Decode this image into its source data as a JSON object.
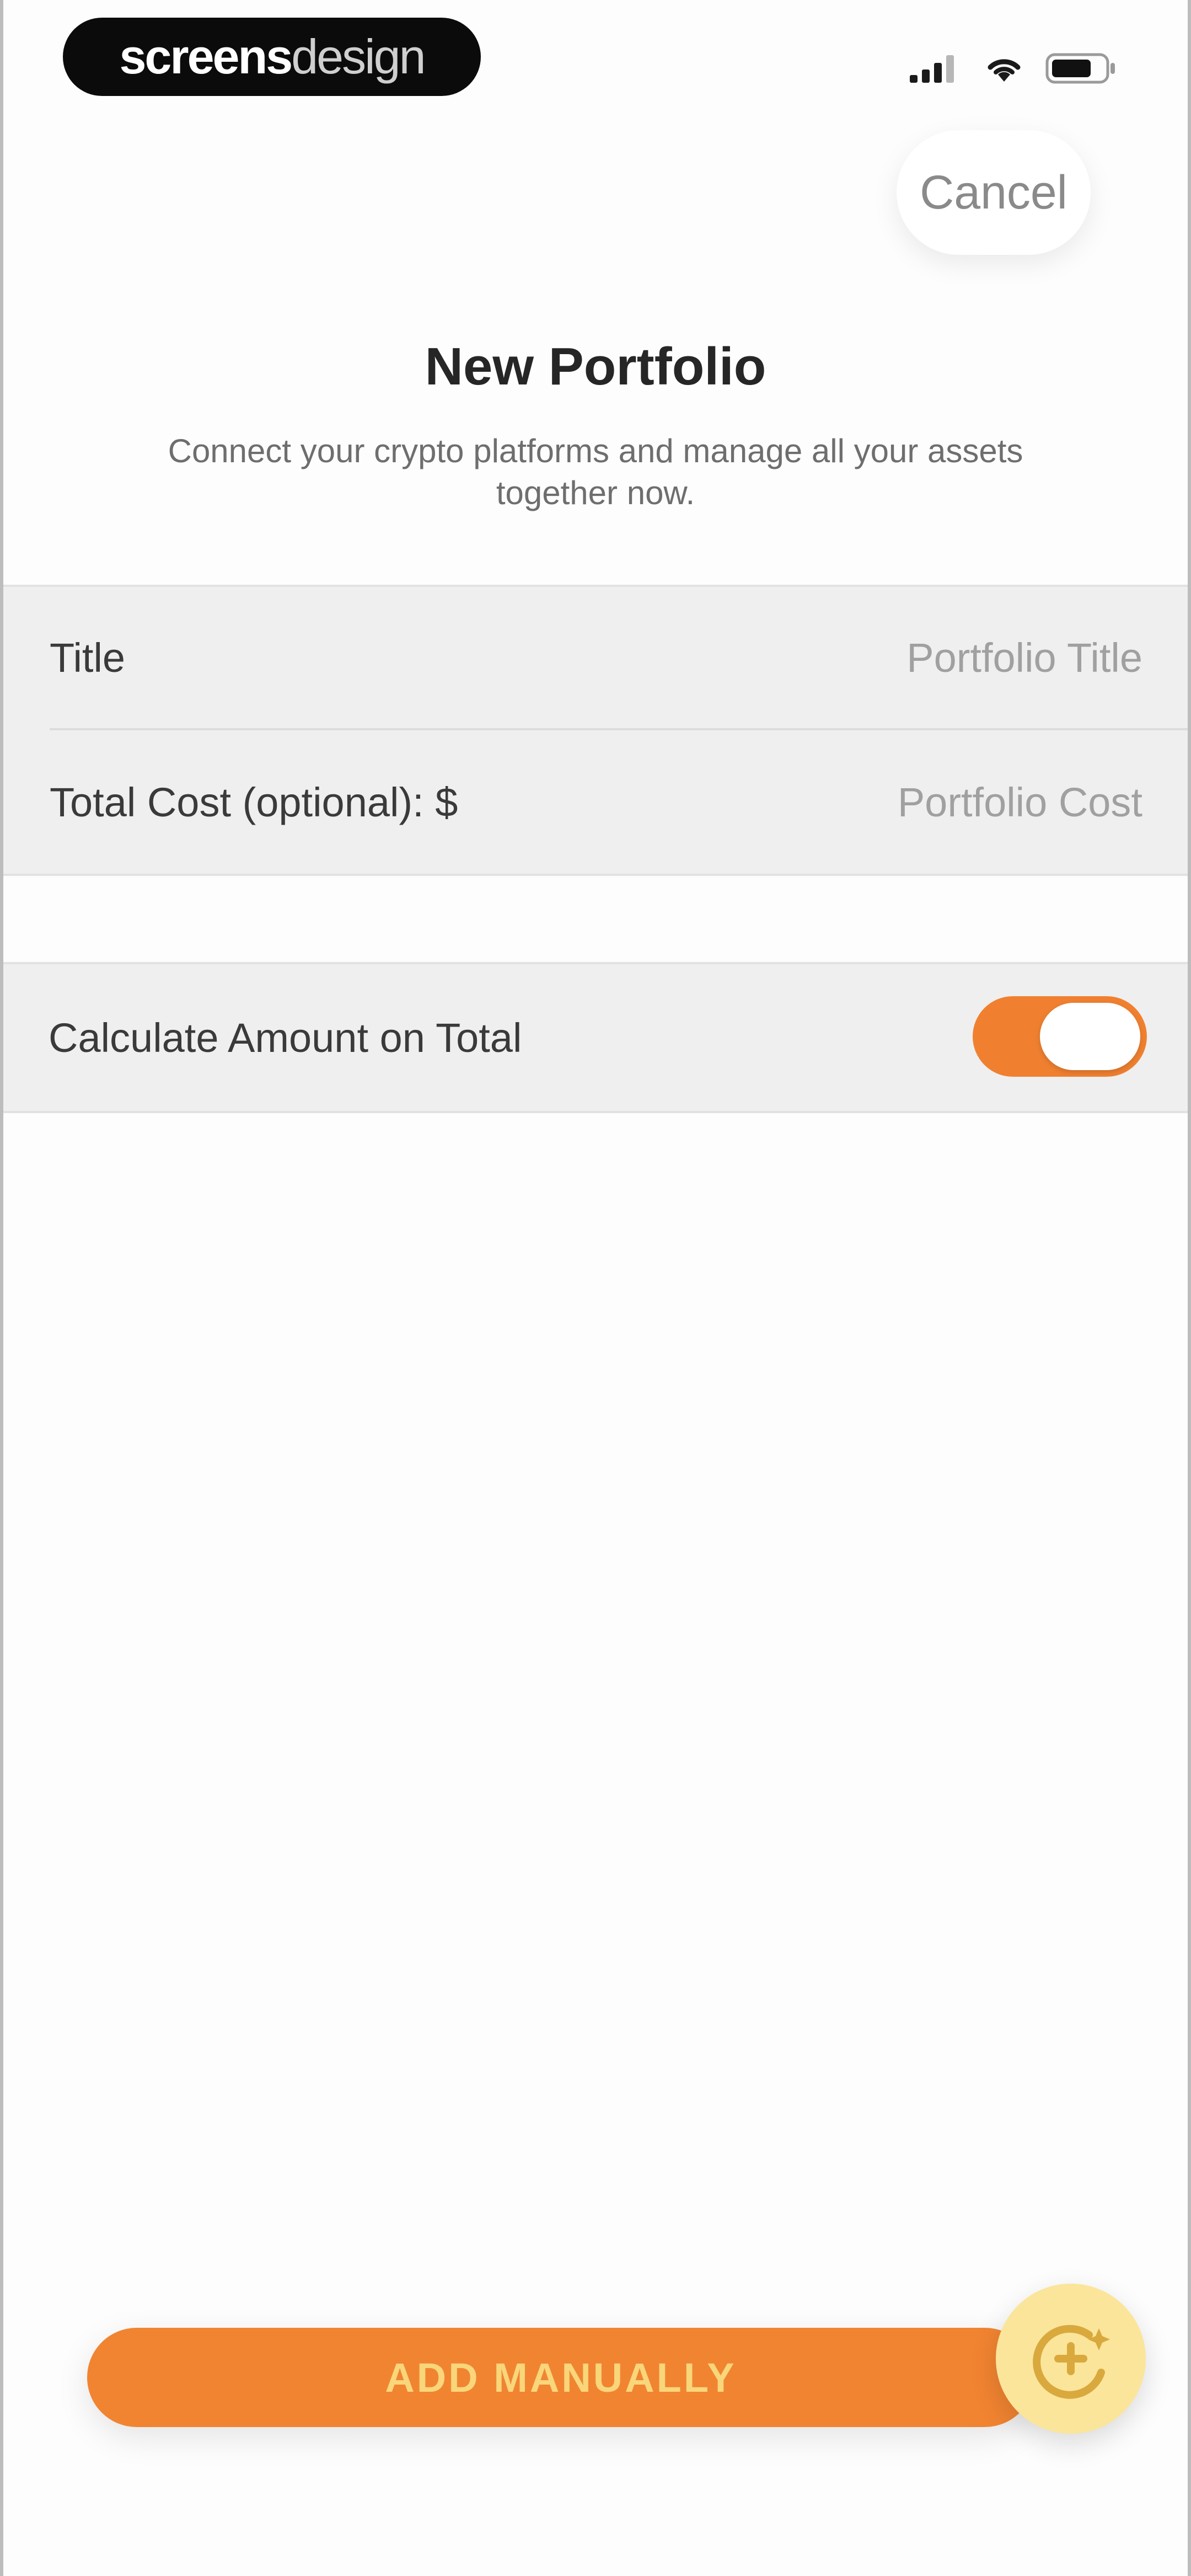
{
  "status_bar": {
    "brand_primary": "screens",
    "brand_secondary": "design",
    "icons": [
      "signal-icon",
      "wifi-icon",
      "battery-icon"
    ]
  },
  "header": {
    "cancel_label": "Cancel",
    "title": "New Portfolio",
    "subtitle": "Connect your crypto platforms and manage all your assets together now."
  },
  "form": {
    "title_label": "Title",
    "title_placeholder": "Portfolio Title",
    "cost_label": "Total Cost (optional): $",
    "cost_placeholder": "Portfolio Cost"
  },
  "toggle": {
    "label": "Calculate Amount on Total",
    "state": "on"
  },
  "footer": {
    "cta_label": "ADD MANUALLY",
    "fab_icon": "sparkle-plus-icon"
  },
  "colors": {
    "accent": "#f18431",
    "cta_text": "#f9d67a",
    "fab_background": "#fbe59a"
  }
}
